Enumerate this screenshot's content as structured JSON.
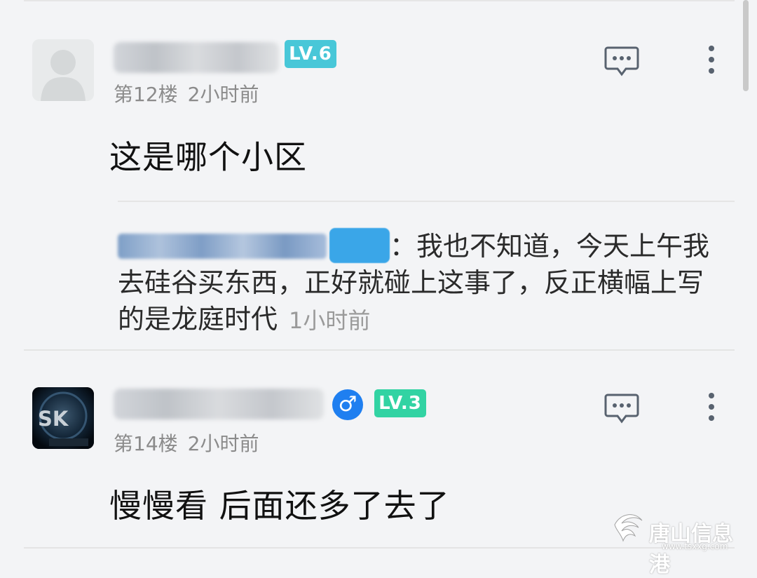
{
  "posts": [
    {
      "level": "LV.6",
      "floor": "第12楼",
      "time": "2小时前",
      "comment": "这是哪个小区"
    },
    {
      "level": "LV.3",
      "floor": "第14楼",
      "time": "2小时前",
      "comment": "慢慢看 后面还多了去了"
    }
  ],
  "reply": {
    "text": "：我也不知道，今天上午我去硅谷买东西，正好就碰上这事了，反正横幅上写的是龙庭时代",
    "time": "1小时前"
  },
  "watermark": {
    "text": "唐山信息港",
    "url": "www.tsxxg.com"
  }
}
